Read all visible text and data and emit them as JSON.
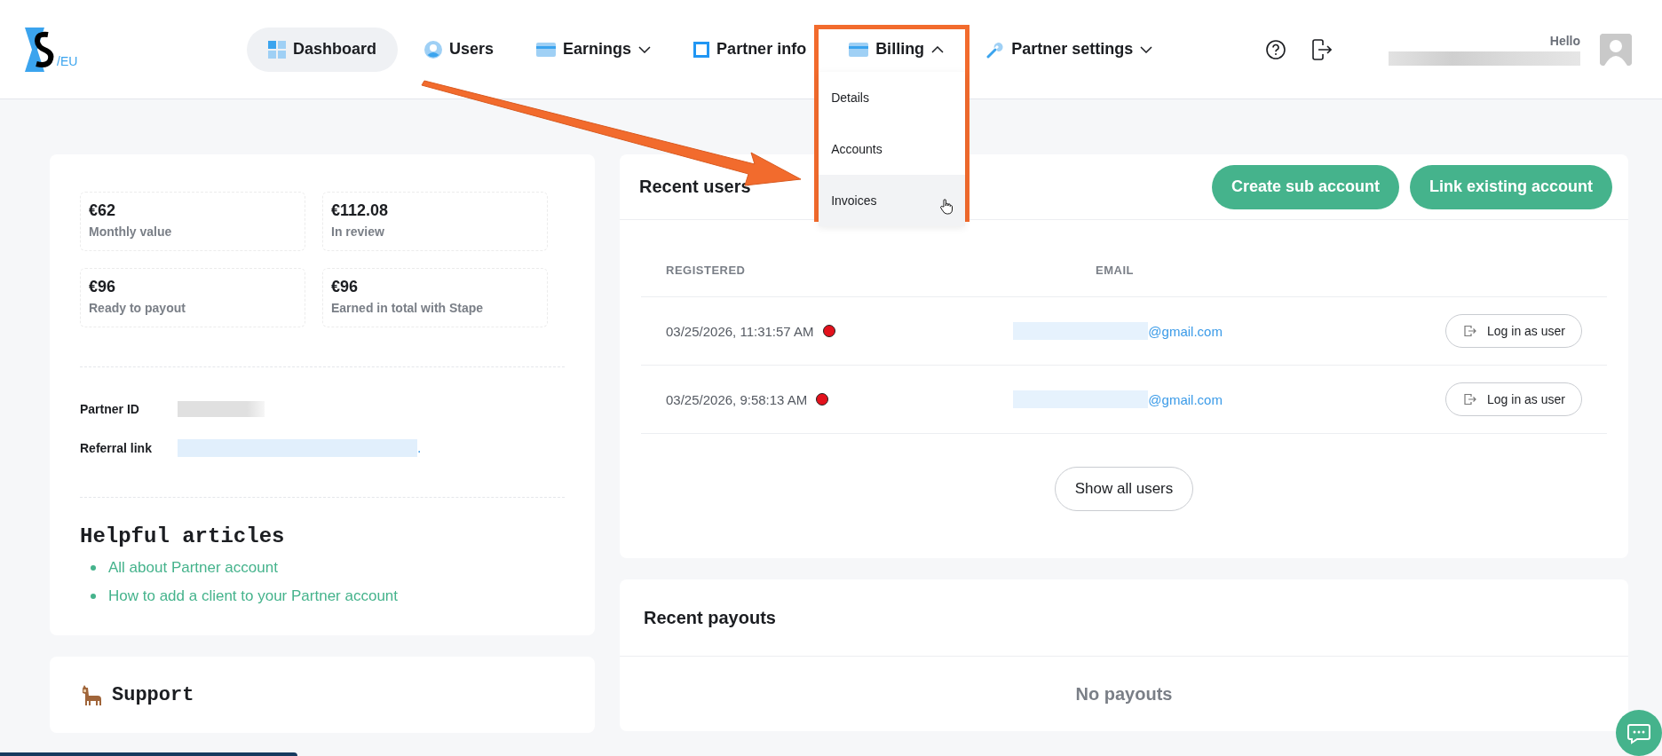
{
  "header": {
    "logo_region": "/EU",
    "nav": [
      {
        "label": "Dashboard",
        "kind": "link",
        "selected": true
      },
      {
        "label": "Users",
        "kind": "link",
        "selected": false
      },
      {
        "label": "Earnings",
        "kind": "dropdown",
        "expanded": false,
        "selected": false
      },
      {
        "label": "Partner info",
        "kind": "link",
        "selected": false
      },
      {
        "label": "Billing",
        "kind": "dropdown",
        "expanded": true,
        "selected": false,
        "menu": [
          {
            "label": "Details",
            "hovered": false
          },
          {
            "label": "Accounts",
            "hovered": false
          },
          {
            "label": "Invoices",
            "hovered": true
          }
        ]
      },
      {
        "label": "Partner settings",
        "kind": "dropdown",
        "expanded": false,
        "selected": false
      }
    ],
    "greeting": "Hello"
  },
  "summary": {
    "stats": [
      {
        "value": "€62",
        "label": "Monthly value"
      },
      {
        "value": "€112.08",
        "label": "In review"
      },
      {
        "value": "€96",
        "label": "Ready to payout"
      },
      {
        "value": "€96",
        "label": "Earned in total with Stape"
      }
    ],
    "fields": [
      {
        "label": "Partner ID"
      },
      {
        "label": "Referral link",
        "suffix": "."
      }
    ],
    "articles_title": "Helpful articles",
    "articles": [
      "All about Partner account",
      "How to add a client to your Partner account"
    ]
  },
  "support": {
    "title": "Support"
  },
  "recent_users": {
    "title": "Recent users",
    "buttons": [
      "Create sub account",
      "Link existing account"
    ],
    "columns": [
      "REGISTERED",
      "EMAIL"
    ],
    "rows": [
      {
        "registered": "03/25/2026, 11:31:57 AM",
        "color": "#e3111c",
        "email": "@gmail.com",
        "action": "Log in as user"
      },
      {
        "registered": "03/25/2026, 9:58:13 AM",
        "color": "#e3111c",
        "email": "@gmail.com",
        "action": "Log in as user"
      }
    ],
    "show_all": "Show all users"
  },
  "recent_payouts": {
    "title": "Recent payouts",
    "empty": "No payouts"
  }
}
